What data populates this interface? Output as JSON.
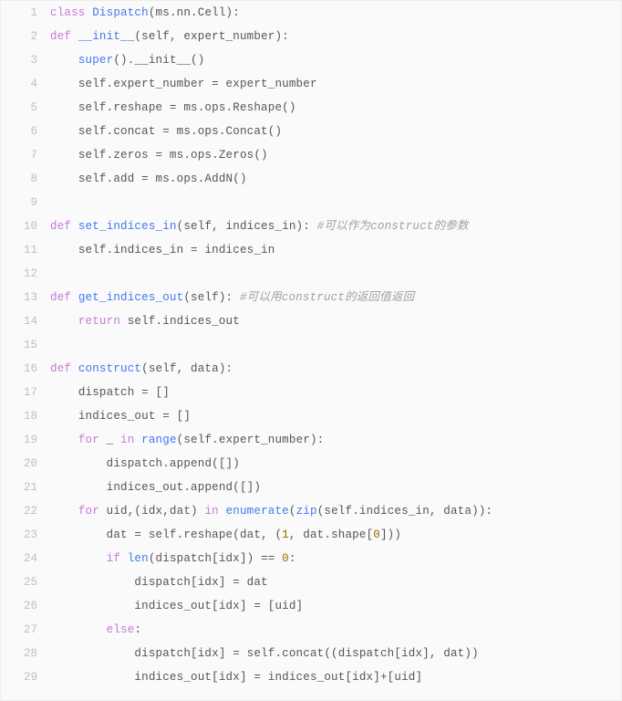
{
  "code": {
    "lines": [
      {
        "n": "1",
        "indent": "",
        "tokens": [
          {
            "t": "class ",
            "c": "tok-kw"
          },
          {
            "t": "Dispatch",
            "c": "tok-class"
          },
          {
            "t": "(ms.nn.Cell):",
            "c": ""
          }
        ]
      },
      {
        "n": "2",
        "indent": "",
        "tokens": [
          {
            "t": "def ",
            "c": "tok-kw"
          },
          {
            "t": "__init__",
            "c": "tok-fn"
          },
          {
            "t": "(self, expert_number):",
            "c": ""
          }
        ]
      },
      {
        "n": "3",
        "indent": "    ",
        "tokens": [
          {
            "t": "super",
            "c": "tok-builtin"
          },
          {
            "t": "().__init__()",
            "c": ""
          }
        ]
      },
      {
        "n": "4",
        "indent": "    ",
        "tokens": [
          {
            "t": "self.expert_number = expert_number",
            "c": ""
          }
        ]
      },
      {
        "n": "5",
        "indent": "    ",
        "tokens": [
          {
            "t": "self.reshape = ms.ops.Reshape()",
            "c": ""
          }
        ]
      },
      {
        "n": "6",
        "indent": "    ",
        "tokens": [
          {
            "t": "self.concat = ms.ops.Concat()",
            "c": ""
          }
        ]
      },
      {
        "n": "7",
        "indent": "    ",
        "tokens": [
          {
            "t": "self.zeros = ms.ops.Zeros()",
            "c": ""
          }
        ]
      },
      {
        "n": "8",
        "indent": "    ",
        "tokens": [
          {
            "t": "self.add = ms.ops.AddN()",
            "c": ""
          }
        ]
      },
      {
        "n": "9",
        "indent": "",
        "tokens": []
      },
      {
        "n": "10",
        "indent": "",
        "tokens": [
          {
            "t": "def ",
            "c": "tok-kw"
          },
          {
            "t": "set_indices_in",
            "c": "tok-fn"
          },
          {
            "t": "(self, indices_in): ",
            "c": ""
          },
          {
            "t": "#可以作为construct的参数",
            "c": "tok-comment"
          }
        ]
      },
      {
        "n": "11",
        "indent": "    ",
        "tokens": [
          {
            "t": "self.indices_in = indices_in",
            "c": ""
          }
        ]
      },
      {
        "n": "12",
        "indent": "",
        "tokens": []
      },
      {
        "n": "13",
        "indent": "",
        "tokens": [
          {
            "t": "def ",
            "c": "tok-kw"
          },
          {
            "t": "get_indices_out",
            "c": "tok-fn"
          },
          {
            "t": "(self): ",
            "c": ""
          },
          {
            "t": "#可以用construct的返回值返回",
            "c": "tok-comment"
          }
        ]
      },
      {
        "n": "14",
        "indent": "    ",
        "tokens": [
          {
            "t": "return ",
            "c": "tok-kw"
          },
          {
            "t": "self.indices_out",
            "c": ""
          }
        ]
      },
      {
        "n": "15",
        "indent": "",
        "tokens": []
      },
      {
        "n": "16",
        "indent": "",
        "tokens": [
          {
            "t": "def ",
            "c": "tok-kw"
          },
          {
            "t": "construct",
            "c": "tok-fn"
          },
          {
            "t": "(self, data):",
            "c": ""
          }
        ]
      },
      {
        "n": "17",
        "indent": "    ",
        "tokens": [
          {
            "t": "dispatch = []",
            "c": ""
          }
        ]
      },
      {
        "n": "18",
        "indent": "    ",
        "tokens": [
          {
            "t": "indices_out = []",
            "c": ""
          }
        ]
      },
      {
        "n": "19",
        "indent": "    ",
        "tokens": [
          {
            "t": "for ",
            "c": "tok-kw"
          },
          {
            "t": "_ ",
            "c": ""
          },
          {
            "t": "in ",
            "c": "tok-kw"
          },
          {
            "t": "range",
            "c": "tok-builtin"
          },
          {
            "t": "(self.expert_number):",
            "c": ""
          }
        ]
      },
      {
        "n": "20",
        "indent": "        ",
        "tokens": [
          {
            "t": "dispatch.append([])",
            "c": ""
          }
        ]
      },
      {
        "n": "21",
        "indent": "        ",
        "tokens": [
          {
            "t": "indices_out.append([])",
            "c": ""
          }
        ]
      },
      {
        "n": "22",
        "indent": "    ",
        "tokens": [
          {
            "t": "for ",
            "c": "tok-kw"
          },
          {
            "t": "uid,(idx,dat) ",
            "c": ""
          },
          {
            "t": "in ",
            "c": "tok-kw"
          },
          {
            "t": "enumerate",
            "c": "tok-builtin"
          },
          {
            "t": "(",
            "c": ""
          },
          {
            "t": "zip",
            "c": "tok-builtin"
          },
          {
            "t": "(self.indices_in, data)):",
            "c": ""
          }
        ]
      },
      {
        "n": "23",
        "indent": "        ",
        "tokens": [
          {
            "t": "dat = self.reshape(dat, (",
            "c": ""
          },
          {
            "t": "1",
            "c": "tok-num"
          },
          {
            "t": ", dat.shape[",
            "c": ""
          },
          {
            "t": "0",
            "c": "tok-num"
          },
          {
            "t": "]))",
            "c": ""
          }
        ]
      },
      {
        "n": "24",
        "indent": "        ",
        "tokens": [
          {
            "t": "if ",
            "c": "tok-kw"
          },
          {
            "t": "len",
            "c": "tok-builtin"
          },
          {
            "t": "(dispatch[idx]) == ",
            "c": ""
          },
          {
            "t": "0",
            "c": "tok-num"
          },
          {
            "t": ":",
            "c": ""
          }
        ]
      },
      {
        "n": "25",
        "indent": "            ",
        "tokens": [
          {
            "t": "dispatch[idx] = dat",
            "c": ""
          }
        ]
      },
      {
        "n": "26",
        "indent": "            ",
        "tokens": [
          {
            "t": "indices_out[idx] = [uid]",
            "c": ""
          }
        ]
      },
      {
        "n": "27",
        "indent": "        ",
        "tokens": [
          {
            "t": "else",
            "c": "tok-kw"
          },
          {
            "t": ":",
            "c": ""
          }
        ]
      },
      {
        "n": "28",
        "indent": "            ",
        "tokens": [
          {
            "t": "dispatch[idx] = self.concat((dispatch[idx], dat))",
            "c": ""
          }
        ]
      },
      {
        "n": "29",
        "indent": "            ",
        "tokens": [
          {
            "t": "indices_out[idx] = indices_out[idx]+[uid]",
            "c": ""
          }
        ]
      }
    ]
  }
}
